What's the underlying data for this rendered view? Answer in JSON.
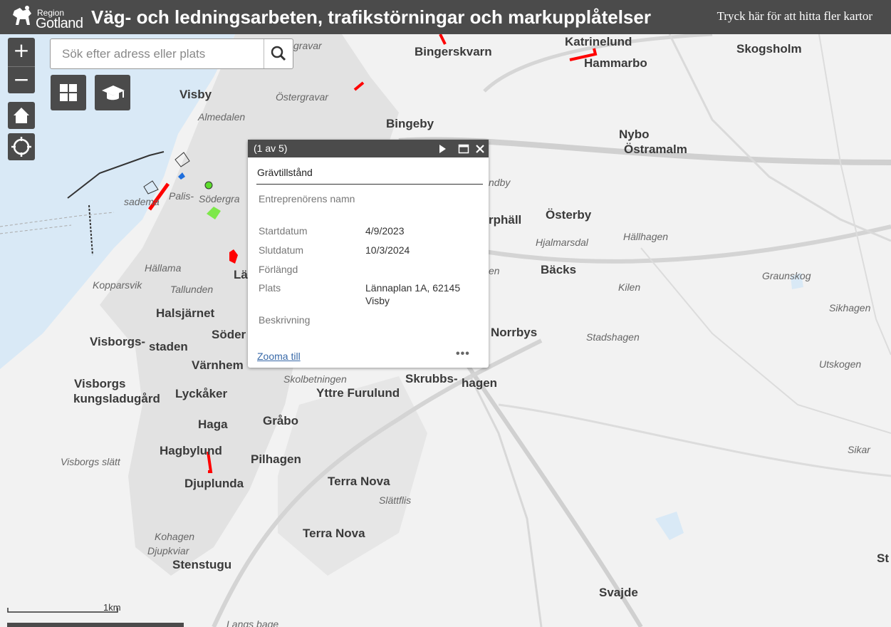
{
  "header": {
    "logo_region": "Region",
    "logo_gotland": "Gotland",
    "title": "Väg- och ledningsarbeten, trafikstörningar och markupplåtelser",
    "link": "Tryck här för att hitta fler kartor"
  },
  "search": {
    "placeholder": "Sök efter adress eller plats"
  },
  "controls": {
    "zoom_in": "+",
    "zoom_out": "−"
  },
  "map": {
    "places_major": [
      "Visby",
      "Bingerskvarn",
      "Katrinelund",
      "Hammarbo",
      "Skogsholm",
      "Bingeby",
      "Nybo",
      "Östramalm",
      "Österby",
      "Bäcks",
      "Norrbys",
      "Halsjärnet",
      "Visborgs-",
      "staden",
      "Värnhem",
      "Visborgs",
      "kungsladugård",
      "Lyckåker",
      "Skrubbs-",
      "hagen",
      "Yttre Furulund",
      "Gråbo",
      "Haga",
      "Hagbylund",
      "Pilhagen",
      "Djuplunda",
      "Terra Nova",
      "Terra Nova",
      "Stenstugu",
      "Svajde",
      "Söder",
      "Lä",
      "rphäll",
      "St"
    ],
    "places_minor": [
      "Östergravar",
      "Almedalen",
      "Palis-",
      "Södergra",
      "sadema",
      "Hällama",
      "Kopparsvik",
      "Tallunden",
      "Hjalmarsdal",
      "Hällhagen",
      "Graunskog",
      "Kilen",
      "Sikhagen",
      "Stadshagen",
      "Utskogen",
      "Sikar",
      "Skolbetningen",
      "Slättflis",
      "Visborgs slätt",
      "Kohagen",
      "Djupkviar",
      "gravar",
      "ndby",
      "en",
      "Langs bage"
    ],
    "scale_label": "1km"
  },
  "popup": {
    "count": "(1 av 5)",
    "title": "Grävtillstånd",
    "fields": [
      {
        "key": "Entreprenörens namn",
        "value": ""
      },
      {
        "key": "Startdatum",
        "value": "4/9/2023"
      },
      {
        "key": "Slutdatum",
        "value": "10/3/2024"
      },
      {
        "key": "Förlängd",
        "value": ""
      },
      {
        "key": "Plats",
        "value": "Lännaplan 1A, 62145 Visby"
      },
      {
        "key": "Beskrivning",
        "value": ""
      }
    ],
    "zoom_link": "Zooma till",
    "more": "•••"
  }
}
